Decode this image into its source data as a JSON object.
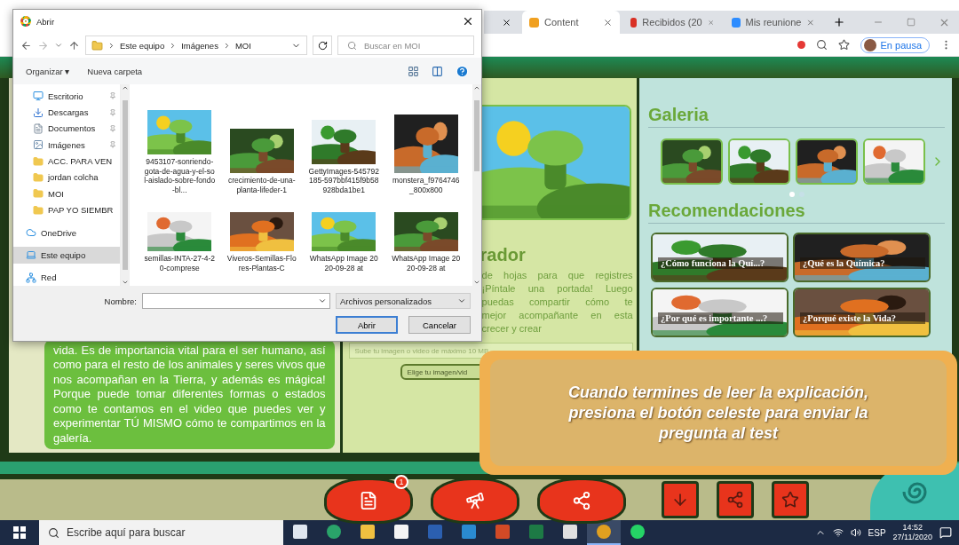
{
  "browser": {
    "tabs": [
      {
        "label": "Content",
        "kind": "content",
        "selected": true
      },
      {
        "label": "Recibidos (20",
        "kind": "mail",
        "selected": false
      },
      {
        "label": "Mis reunione",
        "kind": "video",
        "selected": false
      }
    ],
    "profile_label": "En pausa"
  },
  "dialog": {
    "title": "Abrir",
    "path": [
      "Este equipo",
      "Imágenes",
      "MOI"
    ],
    "search_placeholder": "Buscar en MOI",
    "organize": "Organizar ▾",
    "new_folder": "Nueva carpeta",
    "sidebar": [
      {
        "label": "Escritorio",
        "kind": "desktop",
        "pinned": true,
        "selected": false
      },
      {
        "label": "Descargas",
        "kind": "download",
        "pinned": true,
        "selected": false
      },
      {
        "label": "Documentos",
        "kind": "documents",
        "pinned": true,
        "selected": false
      },
      {
        "label": "Imágenes",
        "kind": "pictures",
        "pinned": true,
        "selected": false
      },
      {
        "label": "ACC. PARA VEN",
        "kind": "folder",
        "pinned": false,
        "selected": false
      },
      {
        "label": "jordan colcha",
        "kind": "folder",
        "pinned": false,
        "selected": false
      },
      {
        "label": "MOI",
        "kind": "folder",
        "pinned": false,
        "selected": false
      },
      {
        "label": "PAP YO SIEMBR",
        "kind": "folder",
        "pinned": false,
        "selected": false
      },
      {
        "label": "OneDrive",
        "kind": "cloud",
        "pinned": false,
        "selected": false
      },
      {
        "label": "Este equipo",
        "kind": "pc",
        "pinned": false,
        "selected": true
      },
      {
        "label": "Red",
        "kind": "network",
        "pinned": false,
        "selected": false
      }
    ],
    "files": [
      {
        "name": "9453107-sonriendo-gota-de-agua-y-el-sol-aislado-sobre-fondo-bl...",
        "kind": "picture"
      },
      {
        "name": "crecimiento-de-una-planta-lifeder-1",
        "kind": "picture"
      },
      {
        "name": "GettyImages-545792185-597bbf415f9b58928bda1be1",
        "kind": "picture"
      },
      {
        "name": "monstera_f9764746_800x800",
        "kind": "picture"
      },
      {
        "name": "semillas-INTA-27-4-20-comprese",
        "kind": "picture"
      },
      {
        "name": "Viveros-Semillas-Flores-Plantas-C",
        "kind": "picture"
      },
      {
        "name": "WhatsApp Image 2020-09-28 at",
        "kind": "picture"
      },
      {
        "name": "WhatsApp Image 2020-09-28 at",
        "kind": "picture"
      }
    ],
    "name_label": "Nombre:",
    "file_type": "Archivos personalizados",
    "open_button": "Abrir",
    "cancel_button": "Cancelar"
  },
  "page": {
    "lesson_text": "vida. Es de importancia vital para el ser humano, así como para el resto de los animales y seres vivos que nos acompañan en la Tierra, y además es mágica! Porque puede tomar diferentes formas o estados como te contamos en el video que puedes ver y experimentar TÚ MISMO cómo te compartimos en la galería.",
    "diary": {
      "picture": {
        "kind": "picture"
      },
      "heading": "rador",
      "text_lines": [
        "de hojas para que registres",
        "¡Píntale una portada! Luego",
        "puedas compartir cómo te",
        "mejor acompañante en esta",
        "crecer y crear"
      ],
      "upload_placeholder": "Sube tu imagen o video de máximo 10 MB",
      "upload_button": "Elige tu imagen/vid"
    },
    "gallery": {
      "title": "Galeria",
      "thumbnails": [
        {
          "kind": "picture"
        },
        {
          "kind": "picture"
        },
        {
          "kind": "picture"
        },
        {
          "kind": "picture"
        }
      ],
      "pager": [
        {
          "selected": true
        },
        {
          "selected": false
        }
      ]
    },
    "recommendations": {
      "title": "Recomendaciones",
      "items": [
        {
          "label": "¿Cómo funciona la Quí...?"
        },
        {
          "label": "¿Qué es la Química?"
        },
        {
          "label": "¿Por qué es importante ...?"
        },
        {
          "label": "¿Porqué existe la Vida?"
        }
      ]
    },
    "message": "Cuando termines de leer la explicación, presiona el botón celeste para enviar la pregunta al test",
    "nav": [
      {
        "kind": "document",
        "badge": "1"
      },
      {
        "kind": "telescope"
      },
      {
        "kind": "molecule"
      },
      {
        "kind": "download"
      },
      {
        "kind": "share"
      },
      {
        "kind": "star"
      }
    ]
  },
  "taskbar": {
    "search_placeholder": "Escribe aquí para buscar",
    "apps": [
      {
        "kind": "taskview",
        "selected": false
      },
      {
        "kind": "edge",
        "selected": false
      },
      {
        "kind": "explorer",
        "selected": false
      },
      {
        "kind": "store",
        "selected": false
      },
      {
        "kind": "word",
        "selected": false
      },
      {
        "kind": "mail",
        "selected": false
      },
      {
        "kind": "powerpoint",
        "selected": false
      },
      {
        "kind": "excel",
        "selected": false
      },
      {
        "kind": "wix",
        "selected": false
      },
      {
        "kind": "chrome",
        "selected": true
      },
      {
        "kind": "whatsapp",
        "selected": false
      }
    ],
    "language": "ESP",
    "time": "14:52",
    "date": "27/11/2020"
  }
}
